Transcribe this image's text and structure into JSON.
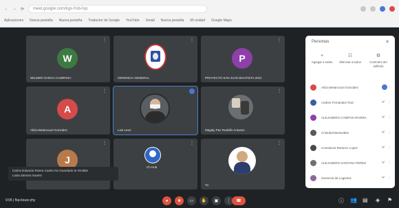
{
  "browser": {
    "url": "meet.google.com/kgx-frxb-fup",
    "bookmarks": [
      "Aplicaciones",
      "Nueva pestaña",
      "Nueva pestaña",
      "Traductor de Google",
      "YouTube",
      "Gmail",
      "Nueva pestaña",
      "Mi unidad",
      "Google Maps"
    ]
  },
  "tiles": [
    {
      "name": "WILMER GARCIA CAMPANA",
      "letter": "W",
      "color": "#3c7a42"
    },
    {
      "name": "GERENCIA GENERAL",
      "kind": "logo"
    },
    {
      "name": "PROYECTO SAN JUAN BAUTISTA 2021",
      "letter": "P",
      "color": "#8e3fa9"
    },
    {
      "name": "Alicia Betancourt Gonzalez",
      "letter": "A",
      "color": "#d64a4a"
    },
    {
      "name": "Luis Leon",
      "kind": "photo"
    },
    {
      "name": "Magaly Paz Rodolfo Antunez",
      "kind": "photo2"
    },
    {
      "name": "",
      "letter": "J",
      "color": "#b87a4a"
    },
    {
      "name": "Ch Hub",
      "kind": "photo3"
    },
    {
      "name": "Tu",
      "kind": "photo4"
    }
  ],
  "caption": {
    "line1": "Carlos Eduardo Rivera Castro No Guardado te Omitido",
    "line2": "Luisa Zamora Suarez"
  },
  "bottom": {
    "time": "9:05 | fkp-bxuw-yhy"
  },
  "panel": {
    "title": "Personas",
    "actions": [
      {
        "icon": "+",
        "label": "Agregar a todos"
      },
      {
        "icon": "☷",
        "label": "Silenciar a todos"
      },
      {
        "icon": "⚙",
        "label": "Controles del anfitrión"
      }
    ],
    "participants": [
      {
        "name": "Alicia Betancourt Gonzalez",
        "color": "#d64a4a"
      },
      {
        "name": "Andres Fernandez Ruiz",
        "color": "#3e5ba8"
      },
      {
        "name": "ALEJANDRO CAMPOS RIVERA",
        "color": "#8e3fa9"
      },
      {
        "name": "Cristobal Benavides",
        "color": "#5a5a5a"
      },
      {
        "name": "Constanza Ramirez Lopez",
        "color": "#4a4a4a"
      },
      {
        "name": "ALEJANDRO SANTANA PEREZ",
        "color": "#707070"
      },
      {
        "name": "Gerencia de Logistica",
        "color": "#8a6a9a"
      }
    ]
  }
}
